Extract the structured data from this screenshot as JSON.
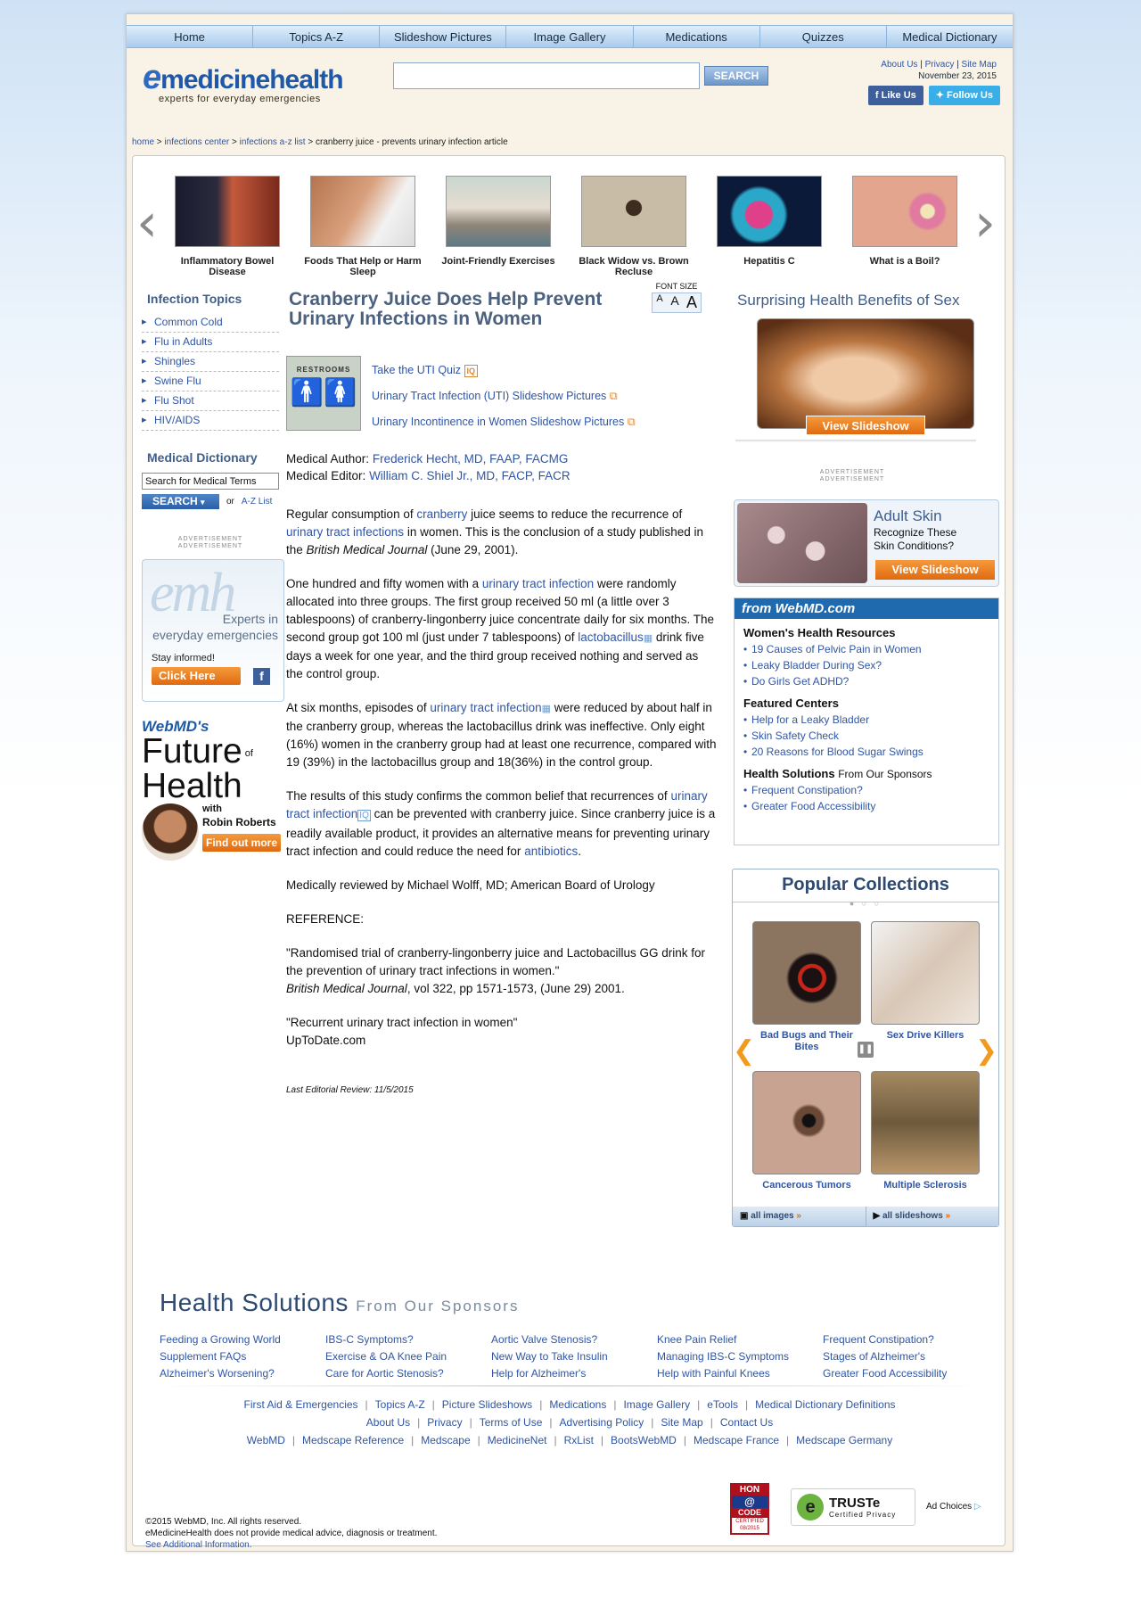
{
  "nav": [
    "Home",
    "Topics A-Z",
    "Slideshow Pictures",
    "Image Gallery",
    "Medications",
    "Quizzes",
    "Medical Dictionary"
  ],
  "header": {
    "logo_brand": "medicinehealth",
    "logo_e": "e",
    "logo_tagline": "experts for everyday emergencies",
    "search_button": "SEARCH",
    "top_links": [
      "About Us",
      "Privacy",
      "Site Map"
    ],
    "date": "November 23, 2015",
    "like_us": "Like Us",
    "follow_us": "Follow Us"
  },
  "breadcrumb": [
    "home",
    "infections center",
    "infections a-z list",
    "cranberry juice - prevents urinary infection article"
  ],
  "carousel": [
    "Inflammatory Bowel Disease",
    "Foods That Help or Harm Sleep",
    "Joint-Friendly Exercises",
    "Black Widow vs. Brown Recluse",
    "Hepatitis C",
    "What is a Boil?"
  ],
  "left": {
    "topics_title": "Infection Topics",
    "topics": [
      "Common Cold",
      "Flu in Adults",
      "Shingles",
      "Swine Flu",
      "Flu Shot",
      "HIV/AIDS"
    ],
    "dict_title": "Medical Dictionary",
    "dict_placeholder": "Search for Medical Terms",
    "dict_search": "SEARCH",
    "or_text": "or",
    "az_list": "A-Z List",
    "ad_label": "ADVERTISEMENT",
    "emh_ad": {
      "brand": "emh",
      "line1": "Experts in",
      "line2": "everyday emergencies",
      "stay": "Stay informed!",
      "click": "Click Here"
    },
    "webmd_ad": {
      "brand": "WebMD's",
      "line1": "Future",
      "of": "of",
      "line2": "Health",
      "with": "with",
      "host": "Robin Roberts",
      "cta": "Find out more"
    }
  },
  "article": {
    "title": "Cranberry Juice Does Help Prevent Urinary Infections in Women",
    "font_size_label": "FONT SIZE",
    "font_sizes": [
      "A",
      "A",
      "A"
    ],
    "restroom_sign": "RESTROOMS",
    "related": [
      "Take the UTI Quiz",
      "Urinary Tract Infection (UTI) Slideshow Pictures",
      "Urinary Incontinence in Women Slideshow Pictures"
    ],
    "quiz_badge": "IQ",
    "author_label": "Medical Author:",
    "author": "Frederick Hecht, MD, FAAP, FACMG",
    "editor_label": "Medical Editor:",
    "editor": "William C. Shiel Jr., MD, FACP, FACR",
    "p1": {
      "a": "Regular consumption of ",
      "link1": "cranberry",
      "b": " juice seems to reduce the recurrence of ",
      "link2": "urinary tract infections",
      "c": " in women. This is the conclusion of a study published in the ",
      "journal": "British Medical Journal",
      "d": " (June 29, 2001)."
    },
    "p2": {
      "a": "One hundred and fifty women with a ",
      "link1": "urinary tract infection",
      "b": " were randomly allocated into three groups. The first group received 50 ml (a little over 3 tablespoons) of cranberry-lingonberry juice concentrate daily for six months. The second group got 100 ml (just under 7 tablespoons) of ",
      "link2": "lactobacillus",
      "c": " drink five days a week for one year, and the third group received nothing and served as the control group."
    },
    "p3": {
      "a": "At six months, episodes of ",
      "link1": "urinary tract infection",
      "b": " were reduced by about half in the cranberry group, whereas the lactobacillus drink was ineffective. Only eight (16%) women in the cranberry group had at least one recurrence, compared with 19 (39%) in the lactobacillus group and 18(36%) in the control group."
    },
    "p4": {
      "a": "The results of this study confirms the common belief that recurrences of ",
      "link1": "urinary tract infection",
      "b": " can be prevented with cranberry juice. Since cranberry juice is a readily available product, it provides an alternative means for preventing urinary tract infection and could reduce the need for ",
      "link2": "antibiotics",
      "c": "."
    },
    "reviewed": "Medically reviewed by Michael Wolff, MD; American Board of Urology",
    "reference_label": "REFERENCE:",
    "ref1": "\"Randomised trial of cranberry-lingonberry juice and Lactobacillus GG drink for the prevention of urinary tract infections in women.\"",
    "ref1_journal": "British Medical Journal",
    "ref1_rest": ", vol 322, pp 1571-1573, (June 29) 2001.",
    "ref2": "\"Recurrent urinary tract infection in women\"",
    "ref2_src": "UpToDate.com",
    "last_review": "Last Editorial Review: 11/5/2015"
  },
  "right": {
    "sex_title": "Surprising Health Benefits of Sex",
    "view_slideshow": "View Slideshow",
    "ad_label": "ADVERTISEMENT",
    "adult_skin": {
      "title": "Adult Skin",
      "sub1": "Recognize These",
      "sub2": "Skin Conditions?",
      "cta": "View Slideshow"
    },
    "webmd_box": {
      "head": "from WebMD.com",
      "sections": [
        {
          "title": "Women's Health Resources",
          "items": [
            "19 Causes of Pelvic Pain in Women",
            "Leaky Bladder During Sex?",
            "Do Girls Get ADHD?"
          ]
        },
        {
          "title": "Featured Centers",
          "items": [
            "Help for a Leaky Bladder",
            "Skin Safety Check",
            "20 Reasons for Blood Sugar Swings"
          ]
        }
      ],
      "hs_title": "Health Solutions",
      "hs_sub": "From Our Sponsors",
      "hs_items": [
        "Frequent Constipation?",
        "Greater Food Accessibility"
      ]
    },
    "popular": {
      "title": "Popular Collections",
      "items": [
        "Bad Bugs and Their Bites",
        "Sex Drive Killers",
        "Cancerous Tumors",
        "Multiple Sclerosis"
      ],
      "all_images": "all images",
      "all_slideshows": "all slideshows"
    }
  },
  "health_solutions": {
    "title": "Health Solutions",
    "sub": "From Our Sponsors",
    "cols": [
      [
        "Feeding a Growing World",
        "Supplement FAQs",
        "Alzheimer's Worsening?"
      ],
      [
        "IBS-C Symptoms?",
        "Exercise & OA Knee Pain",
        "Care for Aortic Stenosis?"
      ],
      [
        "Aortic Valve Stenosis?",
        "New Way to Take Insulin",
        "Help for Alzheimer's"
      ],
      [
        "Knee Pain Relief",
        "Managing IBS-C Symptoms",
        "Help with Painful Knees"
      ],
      [
        "Frequent Constipation?",
        "Stages of Alzheimer's",
        "Greater Food Accessibility"
      ]
    ]
  },
  "footer": {
    "row1": [
      "First Aid & Emergencies",
      "Topics A-Z",
      "Picture Slideshows",
      "Medications",
      "Image Gallery",
      "eTools",
      "Medical Dictionary Definitions"
    ],
    "row2": [
      "About Us",
      "Privacy",
      "Terms of Use",
      "Advertising Policy",
      "Site Map",
      "Contact Us"
    ],
    "row3": [
      "WebMD",
      "Medscape Reference",
      "Medscape",
      "MedicineNet",
      "RxList",
      "BootsWebMD",
      "Medscape France",
      "Medscape Germany"
    ],
    "copyright": "©2015 WebMD, Inc. All rights reserved.",
    "disclaimer": "eMedicineHealth does not provide medical advice, diagnosis or treatment.",
    "additional": "See Additional Information.",
    "hon": {
      "top": "HON",
      "mid": "CODE",
      "cert": "CERTIFIED",
      "date": "08/2015"
    },
    "truste": {
      "brand": "TRUSTe",
      "sub": "Certified Privacy"
    },
    "ad_choices": "Ad Choices"
  }
}
